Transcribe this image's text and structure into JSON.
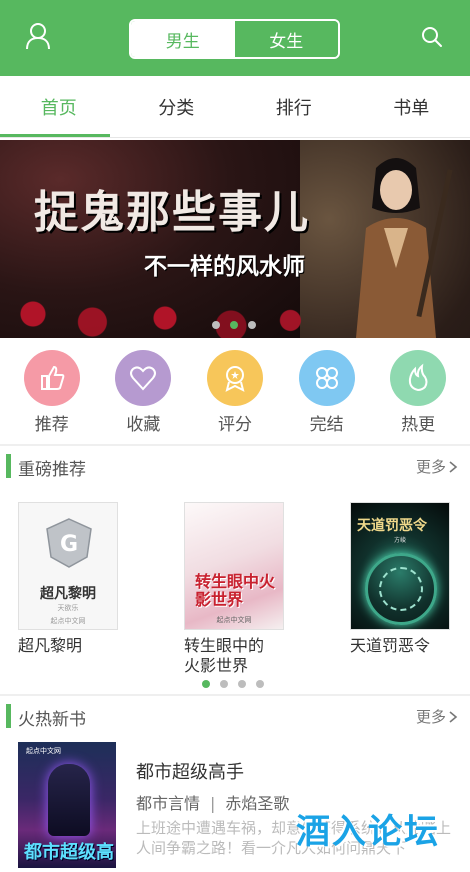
{
  "header": {
    "gender_tabs": [
      {
        "label": "男生",
        "active": true
      },
      {
        "label": "女生",
        "active": false
      }
    ],
    "accent_color": "#57b85f"
  },
  "nav_tabs": [
    {
      "label": "首页",
      "active": true
    },
    {
      "label": "分类",
      "active": false
    },
    {
      "label": "排行",
      "active": false
    },
    {
      "label": "书单",
      "active": false
    }
  ],
  "banner": {
    "title": "捉鬼那些事儿",
    "subtitle": "不一样的风水师",
    "slide_count": 3,
    "active_slide": 2
  },
  "categories": [
    {
      "label": "推荐",
      "icon": "thumbs-up-icon",
      "color": "#f59aa6"
    },
    {
      "label": "收藏",
      "icon": "heart-icon",
      "color": "#b69ad0"
    },
    {
      "label": "评分",
      "icon": "rating-badge-icon",
      "color": "#f7c65a"
    },
    {
      "label": "完结",
      "icon": "clover-icon",
      "color": "#7fc8f2"
    },
    {
      "label": "热更",
      "icon": "flame-icon",
      "color": "#8fd9b0"
    }
  ],
  "featured": {
    "title": "重磅推荐",
    "more": "更多",
    "books": [
      {
        "title": "超凡黎明",
        "cover_title": "超凡黎明",
        "cover_author": "天欲乐",
        "cover_publisher": "起点中文网"
      },
      {
        "title": "转生眼中的火影世界",
        "title_line1": "转生眼中的",
        "title_line2": "火影世界",
        "cover_title": "转生眼中火影世界",
        "cover_publisher": "起点中文网"
      },
      {
        "title": "天道罚恶令",
        "cover_title": "天道罚恶令",
        "cover_author": "方峻"
      }
    ],
    "page_count": 4,
    "active_page": 1
  },
  "hot_new": {
    "title": "火热新书",
    "more": "更多",
    "item": {
      "title": "都市超级高手",
      "genre": "都市言情",
      "author": "赤焰圣歌",
      "desc": "上班途中遭遇车祸，却意外获得系统，从此踏上人间争霸之路！看一介凡人如何问鼎天下",
      "cover_title": "都市超级高手",
      "cover_top": "起点中文网"
    }
  },
  "watermark": "酒入论坛"
}
